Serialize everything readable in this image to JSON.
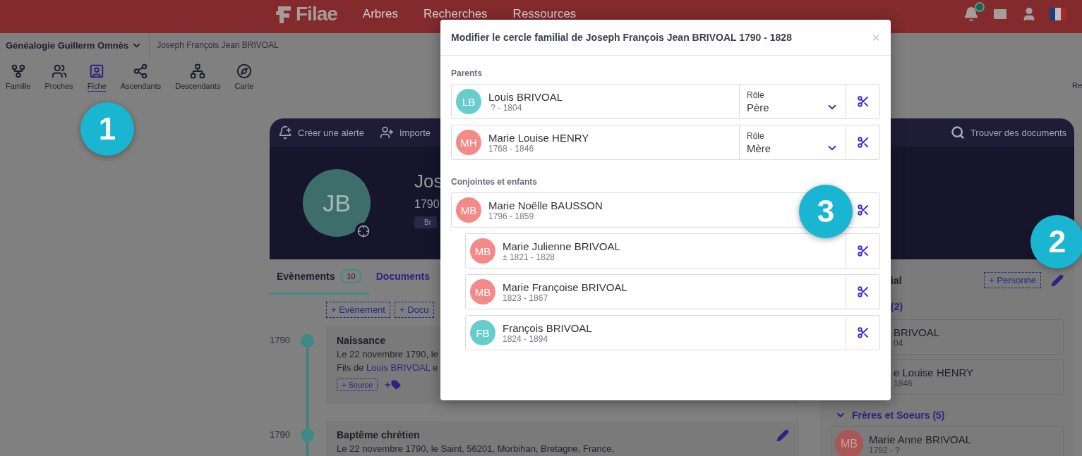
{
  "header": {
    "logo": "Filae",
    "nav": [
      "Arbres",
      "Recherches",
      "Ressources"
    ]
  },
  "breadcrumb": {
    "tree": "Généalogie Guillerm Omnès",
    "person": "Joseph François Jean BRIVOAL"
  },
  "toolbar": [
    {
      "label": "Famille",
      "selected": false
    },
    {
      "label": "Proches",
      "selected": false
    },
    {
      "label": "Fiche",
      "selected": true
    },
    {
      "label": "Ascendants",
      "selected": false
    },
    {
      "label": "Descendants",
      "selected": false
    },
    {
      "label": "Carte",
      "selected": false
    }
  ],
  "toolbar_edge": "Re",
  "profile": {
    "actions": [
      "Créer une alerte",
      "Importe"
    ],
    "find": "Trouver des documents",
    "initials": "JB",
    "name": "Jos",
    "years": "1790",
    "tag": "Br"
  },
  "tabs": [
    {
      "label": "Evènements",
      "count": "10",
      "selected": true
    },
    {
      "label": "Documents",
      "selected": false
    }
  ],
  "add_buttons": [
    "+ Evènement",
    "+ Docu"
  ],
  "events": [
    {
      "year": "1790",
      "title": "Naissance",
      "lines": [
        [
          {
            "text": "Le 22 novembre 1790, le"
          }
        ],
        [
          {
            "text": "Fils de "
          },
          {
            "text": "Louis BRIVOAL",
            "kind": "link"
          },
          {
            "text": " e"
          }
        ]
      ],
      "source": "+ Source",
      "tag_add": "+",
      "pencil": false
    },
    {
      "year": "1790",
      "title": "Baptême chrétien",
      "lines": [
        [
          {
            "text": "Le 22 novembre 1790, le Saint, 56201, Morbihan, Bretagne, France,"
          }
        ]
      ],
      "pencil": true
    }
  ],
  "family_panel": {
    "heading": "ial",
    "add": "+ Personne",
    "parents_heading": "(2)",
    "parents": [
      {
        "name": "BRIVOAL",
        "years": "04"
      },
      {
        "name": "e Louise HENRY",
        "years": "1846"
      }
    ],
    "siblings": {
      "label": "Frères et Soeurs (5)",
      "expanded": true,
      "people": [
        {
          "initials": "MB",
          "name": "Marie Anne BRIVOAL",
          "years": "1792 - ?",
          "color": "#a85656"
        }
      ]
    }
  },
  "callouts": [
    "1",
    "2",
    "3"
  ],
  "dialog": {
    "title": "Modifier le cercle familial de Joseph François Jean BRIVOAL 1790 - 1828",
    "close": "×",
    "sections": [
      {
        "label": "Parents",
        "people": [
          {
            "initials": "LB",
            "name": "Louis BRIVOAL",
            "years": " ? - 1804",
            "color": "#66cccc",
            "role": {
              "label": "Rôle",
              "value": "Père"
            }
          },
          {
            "initials": "MH",
            "name": "Marie Louise HENRY",
            "years": "1768 - 1846",
            "color": "#f48a88",
            "role": {
              "label": "Rôle",
              "value": "Mère"
            }
          }
        ]
      },
      {
        "label": "Conjointes et enfants",
        "people": [
          {
            "initials": "MB",
            "name": "Marie Noëlle BAUSSON",
            "years": "1796 - 1859",
            "color": "#f48a88",
            "children": [
              {
                "initials": "MB",
                "name": "Marie Julienne BRIVOAL",
                "years": "± 1821 - 1828",
                "color": "#f48a88"
              },
              {
                "initials": "MB",
                "name": "Marie Françoise BRIVOAL",
                "years": "1823 - 1867",
                "color": "#f48a88"
              },
              {
                "initials": "FB",
                "name": "François BRIVOAL",
                "years": "1824 - 1894",
                "color": "#66cccc"
              }
            ]
          }
        ]
      }
    ]
  }
}
